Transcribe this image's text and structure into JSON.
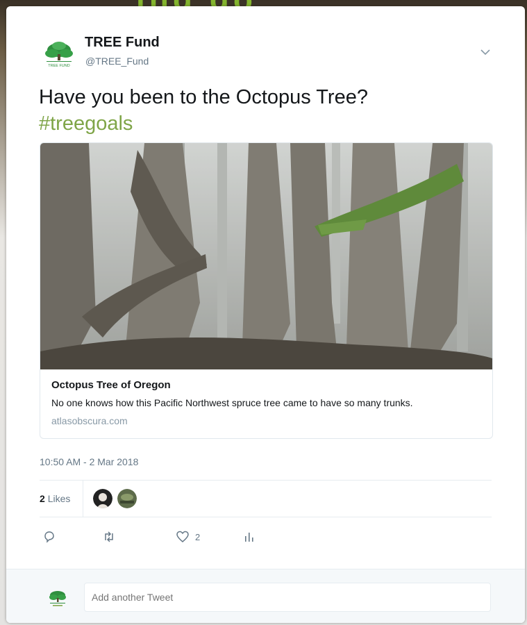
{
  "backdrop": {
    "partial_text": "ing go"
  },
  "tweet": {
    "display_name": "TREE Fund",
    "handle": "@TREE_Fund",
    "text": "Have you been to the Octopus Tree?",
    "hashtag": "#treegoals",
    "timestamp": "10:50 AM - 2 Mar 2018"
  },
  "link_card": {
    "title": "Octopus Tree of Oregon",
    "description": "No one knows how this Pacific Northwest spruce tree came to have so many trunks.",
    "domain": "atlasobscura.com"
  },
  "likes": {
    "count": "2",
    "label": "Likes"
  },
  "actions": {
    "reply_icon": "reply-icon",
    "retweet_icon": "retweet-icon",
    "like_icon": "heart-icon",
    "like_count": "2",
    "analytics_icon": "analytics-icon"
  },
  "reply_box": {
    "placeholder": "Add another Tweet"
  },
  "colors": {
    "hashtag": "#7fa548",
    "brand_green": "#2e8b3e",
    "text": "#14171a",
    "secondary": "#657786"
  },
  "logo": {
    "text": "TREE FUND"
  }
}
